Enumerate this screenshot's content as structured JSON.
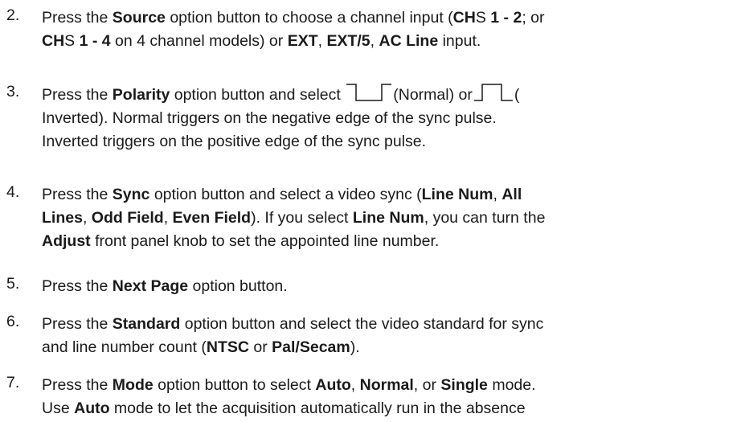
{
  "items": [
    {
      "number": "2.",
      "t": [
        "Press the ",
        "Source",
        " option button to choose a channel input (",
        "CH",
        "S ",
        "1 - 2",
        "; or",
        "CH",
        "S ",
        "1 - 4",
        " on 4 channel models) or ",
        "EXT",
        ", ",
        "EXT/5",
        ", ",
        "AC Line",
        " input."
      ]
    },
    {
      "number": "3.",
      "t": [
        "Press the ",
        "Polarity",
        " option button and select ",
        "(Normal) or",
        "(",
        "Inverted). Normal triggers on the negative edge of the sync pulse.",
        "Inverted triggers on the positive edge of the sync pulse."
      ],
      "icons": [
        "normal-polarity-icon",
        "inverted-polarity-icon"
      ]
    },
    {
      "number": "4.",
      "t": [
        "Press the ",
        "Sync",
        " option button and select a video sync (",
        "Line Num",
        ", ",
        "All",
        "Lines",
        ", ",
        "Odd Field",
        ", ",
        "Even Field",
        "). If you select ",
        "Line Num",
        ", you can turn the",
        "Adjust",
        " front panel knob to set the appointed line number."
      ]
    },
    {
      "number": "5.",
      "t": [
        "Press the ",
        "Next Page",
        " option button."
      ]
    },
    {
      "number": "6.",
      "t": [
        "Press the ",
        "Standard",
        " option button and select the video standard for sync",
        "and line number count (",
        "NTSC",
        " or ",
        "Pal/Secam",
        ")."
      ]
    },
    {
      "number": "7.",
      "t": [
        "Press the ",
        "Mode",
        " option button to select ",
        "Auto",
        ", ",
        "Normal",
        ", or ",
        "Single",
        " mode.",
        "Use ",
        "Auto",
        " mode to let the acquisition automatically run in the absence"
      ]
    }
  ]
}
